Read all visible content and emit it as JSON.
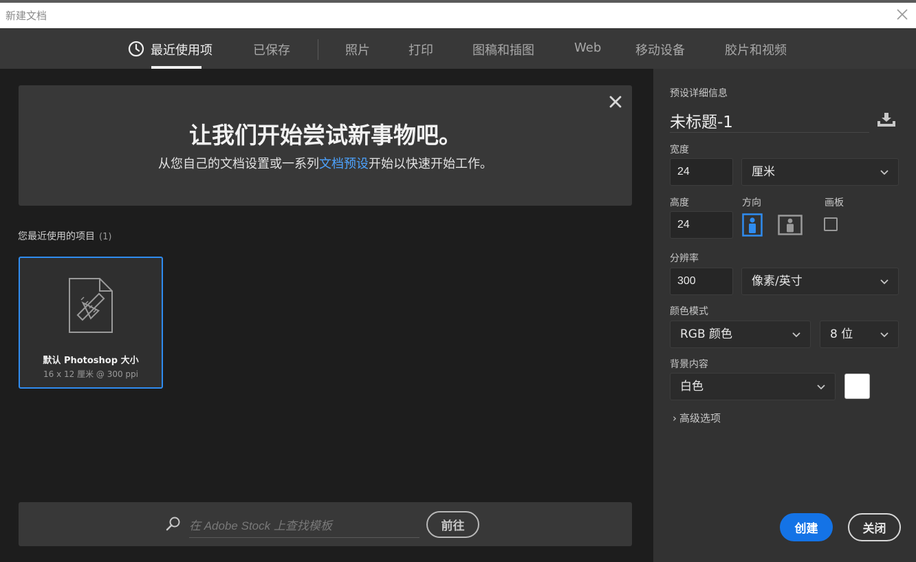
{
  "window": {
    "title": "新建文档"
  },
  "tabs": [
    {
      "label": "最近使用项",
      "active": true
    },
    {
      "label": "已保存"
    },
    {
      "label": "照片"
    },
    {
      "label": "打印"
    },
    {
      "label": "图稿和插图"
    },
    {
      "label": "Web"
    },
    {
      "label": "移动设备"
    },
    {
      "label": "胶片和视频"
    }
  ],
  "banner": {
    "title": "让我们开始尝试新事物吧。",
    "subtitle_before": "从您自己的文档设置或一系列",
    "subtitle_link": "文档预设",
    "subtitle_after": "开始以快速开始工作。"
  },
  "recent": {
    "label": "您最近使用的项目",
    "count": "(1)",
    "items": [
      {
        "title": "默认 Photoshop 大小",
        "subtitle": "16 x 12 厘米 @ 300 ppi"
      }
    ]
  },
  "stock": {
    "placeholder": "在 Adobe Stock 上查找模板",
    "go_label": "前往"
  },
  "preset": {
    "section_label": "预设详细信息",
    "name": "未标题-1",
    "width_label": "宽度",
    "width_value": "24",
    "width_unit": "厘米",
    "height_label": "高度",
    "height_value": "24",
    "orientation_label": "方向",
    "orientation_selected": "portrait",
    "artboard_label": "画板",
    "artboard_checked": false,
    "resolution_label": "分辨率",
    "resolution_value": "300",
    "resolution_unit": "像素/英寸",
    "color_mode_label": "颜色模式",
    "color_mode": "RGB 颜色",
    "bit_depth": "8 位",
    "background_label": "背景内容",
    "background": "白色",
    "background_color": "#ffffff",
    "advanced_label": "高级选项"
  },
  "actions": {
    "create_label": "创建",
    "close_label": "关闭"
  },
  "colors": {
    "accent": "#1473e6",
    "selection_border": "#2f8cf0",
    "link": "#4da3ff"
  }
}
